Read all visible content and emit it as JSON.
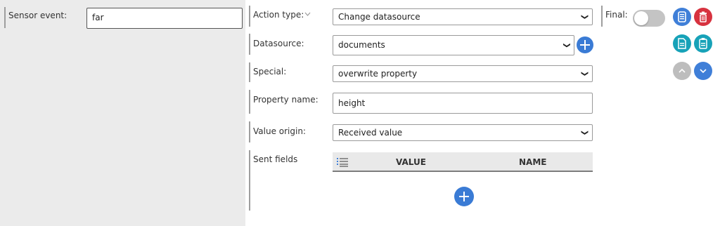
{
  "sensor": {
    "label": "Sensor event:",
    "value": "far"
  },
  "action_type": {
    "label": "Action type:",
    "value": "Change datasource"
  },
  "final": {
    "label": "Final:",
    "toggled": false
  },
  "datasource": {
    "label": "Datasource:",
    "value": "documents"
  },
  "special": {
    "label": "Special:",
    "value": "overwrite property"
  },
  "property_name": {
    "label": "Property name:",
    "value": "height"
  },
  "value_origin": {
    "label": "Value origin:",
    "value": "Received value"
  },
  "sent_fields": {
    "label": "Sent fields",
    "columns": [
      "VALUE",
      "NAME"
    ],
    "rows": []
  },
  "icons": {
    "copy": "copy-icon",
    "delete": "trash-icon",
    "export": "document-export-icon",
    "paste": "clipboard-icon",
    "move_up": "chevron-up-icon",
    "move_down": "chevron-down-icon",
    "add": "plus-icon",
    "list": "list-icon"
  },
  "colors": {
    "accent_blue": "#3f7fd8",
    "danger_red": "#d7323f",
    "teal": "#17a2b8",
    "disabled_gray": "#bdbdbd",
    "left_panel_bg": "#ebebeb"
  }
}
